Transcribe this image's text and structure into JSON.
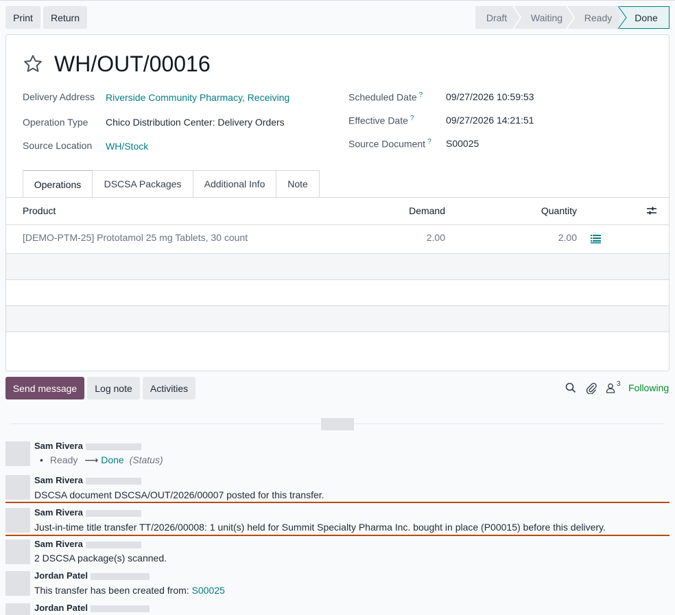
{
  "control": {
    "print_label": "Print",
    "return_label": "Return"
  },
  "statusbar": {
    "stages": [
      "Draft",
      "Waiting",
      "Ready",
      "Done"
    ],
    "active": "Done"
  },
  "record": {
    "name": "WH/OUT/00016",
    "fields_left": [
      {
        "label": "Delivery Address",
        "value": "Riverside Community Pharmacy, Receiving"
      },
      {
        "label": "Operation Type",
        "value": "Chico Distribution Center: Delivery Orders"
      },
      {
        "label": "Source Location",
        "value": "WH/Stock"
      }
    ],
    "fields_right": [
      {
        "label": "Scheduled Date",
        "help": "?",
        "value": "09/27/2026 10:59:53"
      },
      {
        "label": "Effective Date",
        "help": "?",
        "value": "09/27/2026 14:21:51"
      },
      {
        "label": "Source Document",
        "help": "?",
        "value": "S00025"
      }
    ]
  },
  "tabs": [
    "Operations",
    "DSCSA Packages",
    "Additional Info",
    "Note"
  ],
  "table": {
    "headers": {
      "product": "Product",
      "demand": "Demand",
      "quantity": "Quantity"
    },
    "rows": [
      {
        "product": "[DEMO-PTM-25] Prototamol 25 mg Tablets, 30 count",
        "demand": "2.00",
        "quantity": "2.00"
      }
    ]
  },
  "chatter": {
    "send_message": "Send message",
    "log_note": "Log note",
    "activities": "Activities",
    "follower_count": "3",
    "following": "Following",
    "messages": [
      {
        "author": "Sam Rivera",
        "tracking": {
          "from": "Ready",
          "arrow": "⟶",
          "to": "Done",
          "field": "(Status)"
        }
      },
      {
        "author": "Sam Rivera",
        "body": "DSCSA document DSCSA/OUT/2026/00007 posted for this transfer."
      },
      {
        "author": "Sam Rivera",
        "body": "Just-in-time title transfer TT/2026/00008: 1 unit(s) held for Summit Specialty Pharma Inc. bought in place (P00015) before this delivery."
      },
      {
        "author": "Sam Rivera",
        "body": "2 DSCSA package(s) scanned."
      },
      {
        "author": "Jordan Patel",
        "body": "This transfer has been created from: ",
        "link": "S00025"
      },
      {
        "author": "Jordan Patel"
      }
    ]
  },
  "colors": {
    "primary": "#714b67",
    "link": "#017e84",
    "following": "#008e2d",
    "highlight_line": "#b74c0a"
  }
}
